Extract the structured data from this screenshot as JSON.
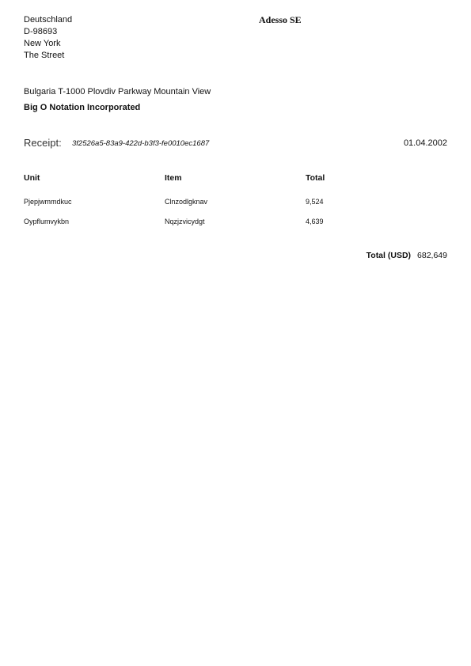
{
  "sender": {
    "country": "Deutschland",
    "postal_code": "D-98693",
    "city": "New York",
    "street": "The Street"
  },
  "company": {
    "name": "Adesso SE"
  },
  "recipient": {
    "address": "Bulgaria T-1000 Plovdiv Parkway Mountain View",
    "name": "Big O Notation Incorporated"
  },
  "receipt": {
    "label": "Receipt:",
    "id": "3f2526a5-83a9-422d-b3f3-fe0010ec1687",
    "date": "01.04.2002"
  },
  "table": {
    "headers": {
      "unit": "Unit",
      "item": "Item",
      "total": "Total"
    },
    "rows": [
      {
        "unit": "Pjepjwmmdkuc",
        "item": "Clnzodlgknav",
        "total": "9,524"
      },
      {
        "unit": "Oypflumvykbn",
        "item": "Nqzjzvicydgt",
        "total": "4,639"
      }
    ]
  },
  "summary": {
    "total_label": "Total (USD)",
    "total_value": "682,649"
  }
}
